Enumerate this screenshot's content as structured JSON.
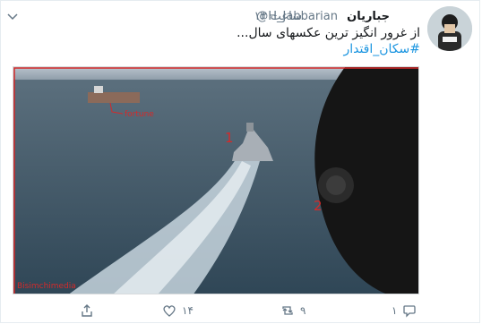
{
  "author": {
    "name": "جباریان",
    "handle": "@H_Jabbarian",
    "separator": "·",
    "time": "۱۳ ساعت"
  },
  "tweet": {
    "text": "از غرور انگیز ترین عکسهای سال...",
    "hashtag": "#سکان_اقتدار"
  },
  "media": {
    "labels": {
      "ship_name": "fortune",
      "marker_1": "1",
      "marker_2": "2",
      "watermark": "Bisimchimedia"
    }
  },
  "actions": {
    "reply_icon": "reply-icon",
    "retweet_icon": "retweet-icon",
    "retweet_count": "۹",
    "like_icon": "heart-icon",
    "like_count": "۱",
    "share_icon": "share-icon",
    "share_count": "۱۴"
  },
  "colors": {
    "accent": "#1b95e0",
    "annotation": "#d42a2a",
    "muted": "#657786"
  }
}
